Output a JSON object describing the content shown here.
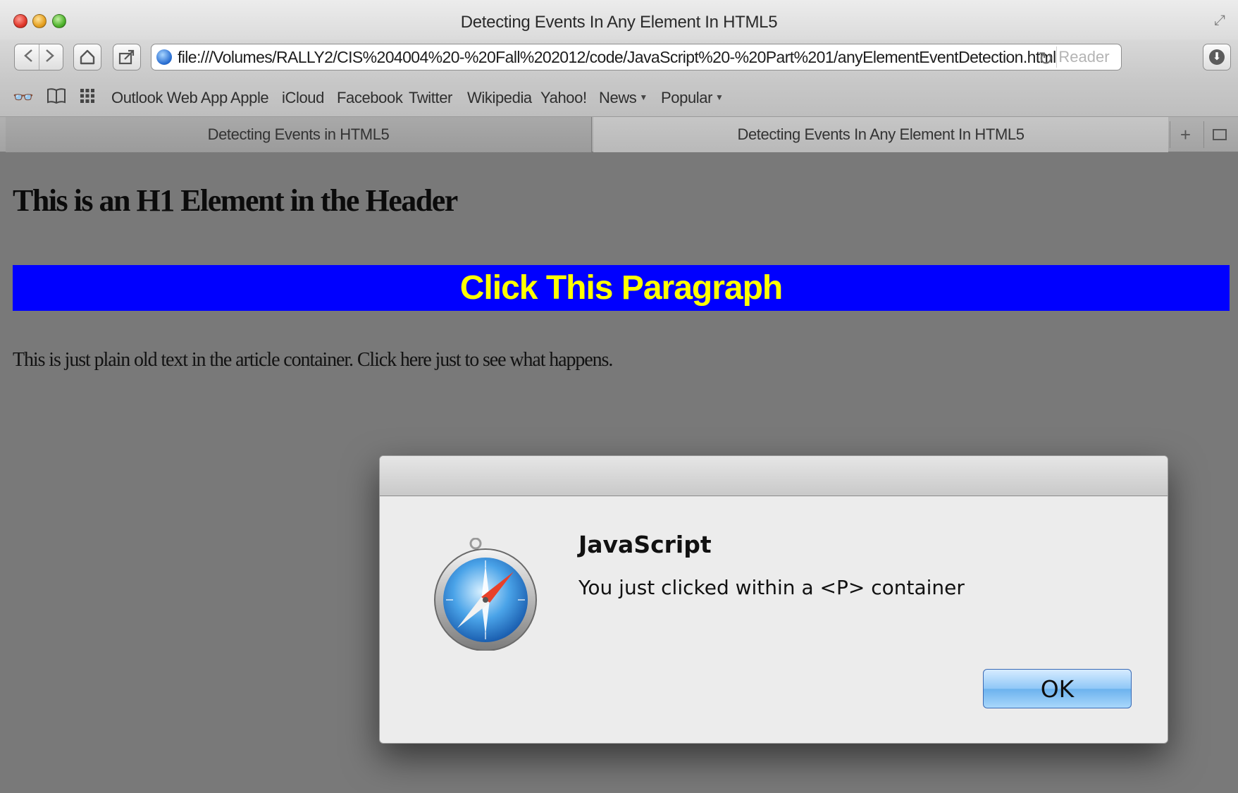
{
  "window": {
    "title": "Detecting Events In Any Element In HTML5"
  },
  "toolbar": {
    "url": "file:///Volumes/RALLY2/CIS%204004%20-%20Fall%202012/code/JavaScript%20-%20Part%201/anyElementEventDetection.html",
    "reader_label": "Reader"
  },
  "bookmarks": [
    {
      "label": "Outlook Web App",
      "has_menu": false
    },
    {
      "label": "Apple",
      "has_menu": false
    },
    {
      "label": "iCloud",
      "has_menu": false
    },
    {
      "label": "Facebook",
      "has_menu": false
    },
    {
      "label": "Twitter",
      "has_menu": false
    },
    {
      "label": "Wikipedia",
      "has_menu": false
    },
    {
      "label": "Yahoo!",
      "has_menu": false
    },
    {
      "label": "News",
      "has_menu": true
    },
    {
      "label": "Popular",
      "has_menu": true
    }
  ],
  "tabs": [
    {
      "label": "Detecting Events in HTML5",
      "active": false
    },
    {
      "label": "Detecting Events In Any Element In HTML5",
      "active": true
    }
  ],
  "page": {
    "header_h1": "This is an H1 Element in the Header",
    "click_paragraph": "Click This Paragraph",
    "plain_text": "This is just plain old text in the article container. Click here just to see what happens.",
    "colors": {
      "paragraph_bg": "#0000ff",
      "paragraph_text": "#ffff00"
    }
  },
  "dialog": {
    "heading": "JavaScript",
    "message": "You just clicked within a <P> container",
    "ok_label": "OK",
    "icon": "safari-compass-icon"
  }
}
